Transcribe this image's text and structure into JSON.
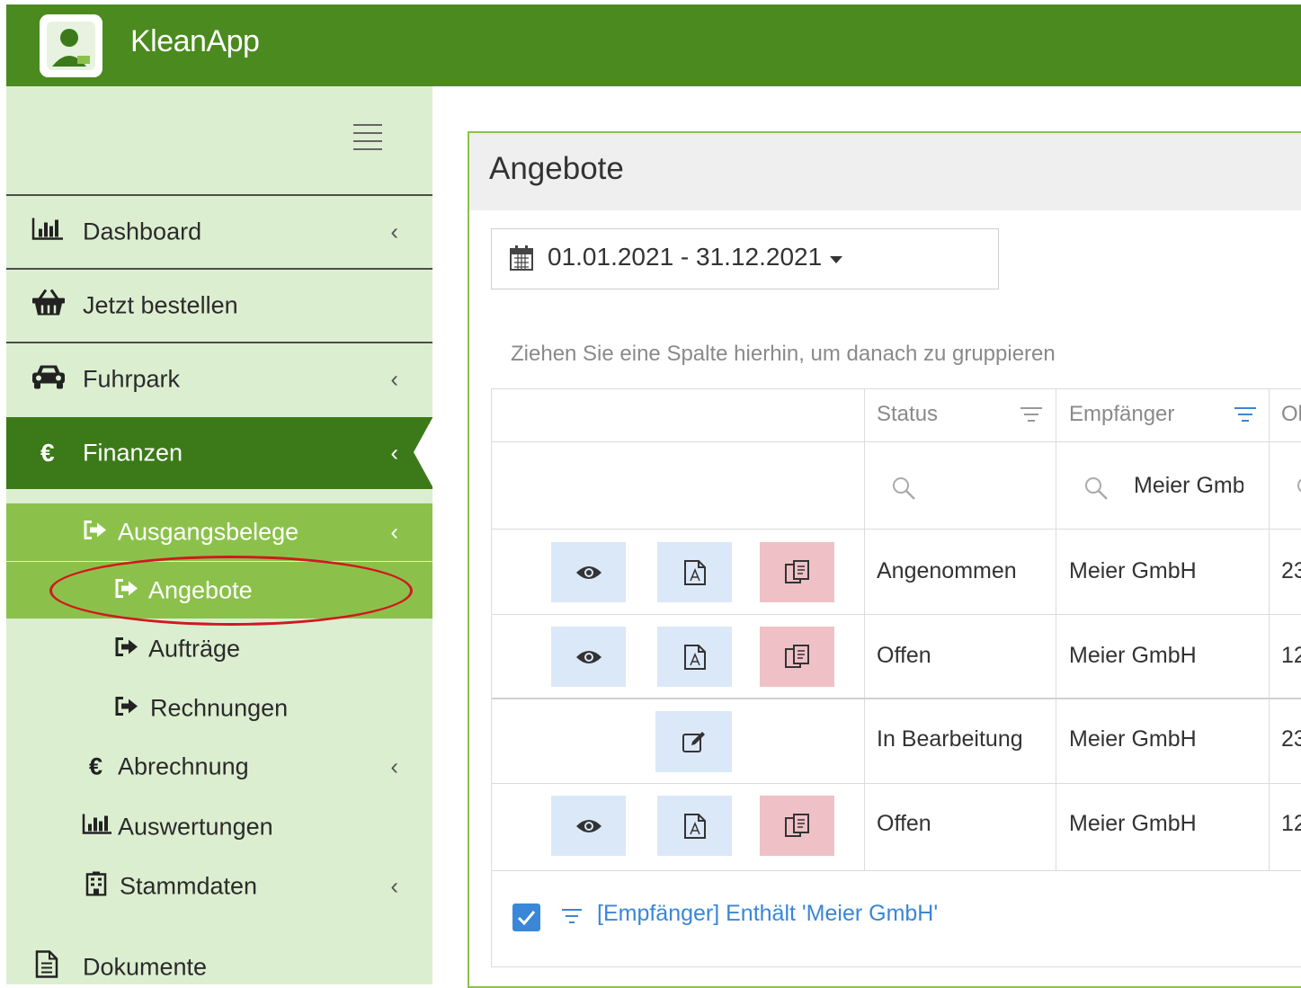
{
  "app": {
    "title": "KleanApp"
  },
  "sidebar": {
    "items": [
      {
        "label": "Dashboard",
        "icon": "bar-chart-icon"
      },
      {
        "label": "Jetzt bestellen",
        "icon": "basket-icon"
      },
      {
        "label": "Fuhrpark",
        "icon": "car-icon"
      },
      {
        "label": "Finanzen",
        "icon": "euro-icon"
      }
    ],
    "finanzen_sub": [
      {
        "label": "Ausgangsbelege",
        "icon": "sign-out-icon"
      },
      {
        "label": "Abrechnung",
        "icon": "euro-icon"
      },
      {
        "label": "Auswertungen",
        "icon": "bar-chart-icon"
      },
      {
        "label": "Stammdaten",
        "icon": "building-icon"
      }
    ],
    "ausgangsbelege_sub": [
      {
        "label": "Angebote",
        "icon": "sign-out-icon",
        "active": true
      },
      {
        "label": "Aufträge",
        "icon": "sign-out-icon"
      },
      {
        "label": "Rechnungen",
        "icon": "sign-out-icon"
      }
    ],
    "bottom_item": {
      "label": "Dokumente",
      "icon": "document-icon"
    }
  },
  "main": {
    "title": "Angebote",
    "date_range": "01.01.2021 - 31.12.2021",
    "group_hint": "Ziehen Sie eine Spalte hierhin, um danach zu gruppieren",
    "columns": [
      "Status",
      "Empfänger",
      "Ol"
    ],
    "filter_row": {
      "empfaenger_value": "Meier Gmb"
    },
    "rows": [
      {
        "status": "Angenommen",
        "empfaenger": "Meier GmbH",
        "col3": "23"
      },
      {
        "status": "Offen",
        "empfaenger": "Meier GmbH",
        "col3": "12"
      },
      {
        "status": "In Bearbeitung",
        "empfaenger": "Meier GmbH",
        "col3": "23"
      },
      {
        "status": "Offen",
        "empfaenger": "Meier GmbH",
        "col3": "12"
      }
    ],
    "filter_summary": "[Empfänger] Enthält 'Meier GmbH'"
  },
  "colors": {
    "topbar": "#4a8a1e",
    "sidebar_bg": "#dceed0",
    "active_dark": "#3c7a19",
    "active_light": "#8bc14a",
    "accent_blue": "#3a86d8",
    "highlight_red": "#d0191f"
  }
}
